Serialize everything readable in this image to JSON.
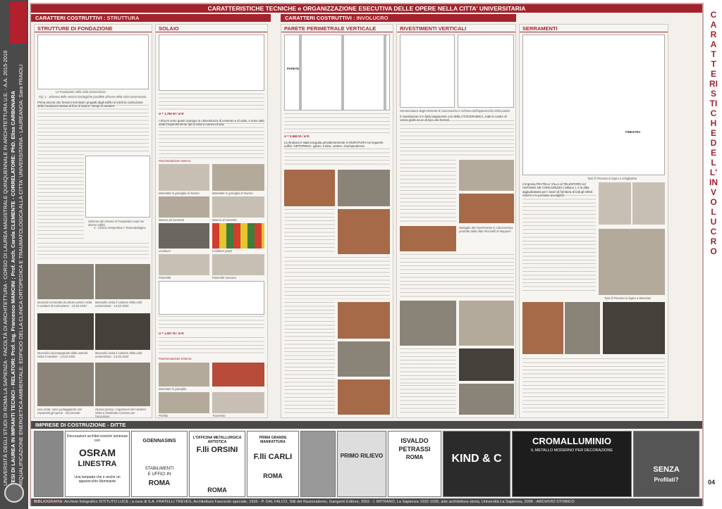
{
  "left_band": {
    "line1": "UNIVERSITÀ DEGLI STUDI DI ROMA  LA SAPIENZA  - FACOLTÀ DI ARCHITETTURA - CORSO DI LAUREA MAGISTRALE QUINQUENNALE IN ARCHITETTURA U.E. - A.A. 2015-2016",
    "line2": "TESI DI LAUREA IN IMPIANTI TECNICI - RELATORI: Prof. Ing. Francesco MANCINI ; Prof. Arch. Carola CLEMENTE - CORRELATORE: PhD. Elisa CARBONARA",
    "line3": "RIQUALIFICAZIONE ENERGETICA AMBIENTALE: EDIFICIO DELLA CLINICA ORTOPEDICA E TRAUMATOLOGICA ALLA CITTA' UNIVERSITARIA  - LAUREANDA: Sara FRAIOLI"
  },
  "banner": "CARATTERISTICHE TECNICHE e ORGANIZZAZIONE ESECUTIVA DELLE OPERE NELLA CITTA' UNIVERSITARIA",
  "sections": {
    "strutt_prefix": "CARATTERI COSTRUTTIVI : ",
    "strutt": "STRUTTURA",
    "invol_prefix": "CARATTERI COSTRUTTIVI : ",
    "invol": "INVOLUCRO"
  },
  "columns": {
    "c1": "STRUTTURE DI FONDAZIONE",
    "c2": "SOLAIO",
    "c3": "PARETE PERIMETRALE VERTICALE",
    "c4": "RIVESTIMENTI VERTICALI",
    "c5": "SERRAMENTI"
  },
  "captions": {
    "fond": "Le Fondazioni nella Città Universitaria",
    "fig1": "Fig. 1 - Schema delle sezioni Geologiche parallele all'asse della Città Universitaria",
    "schema_fond": "Schema dei sistemi di Fondazioni usati nei diversi edifici",
    "fig4": "4 - Clinica Ortopedica e Traumatologica",
    "marmo_grig": "Marmette in graniglia di marmo",
    "marmo_grig2": "Marmette in graniglia di marmo",
    "marmo_cemento": "Marmo ad cemento",
    "marmo_cerata": "Marmo al cemento",
    "linoleum": "Linoleum",
    "linoleum_jaspè": "Linoleum jaspè",
    "pavimenti_interni": "Pavimentazione Interna",
    "pavimenti_esterni": "Pavimentazione Esterna",
    "piastrelle": "Piastrelle",
    "piastrelle_mosaico": "Piastrelle mosaico",
    "marmette_gr": "Marmette in graniglia",
    "porfido": "Porfido",
    "travertino": "Travertino",
    "musiche1": "Musicisti circondati da alcuni uomini visita il cantiere di costruzione - 14.03.1933",
    "musiche2": "Mussolini visita il cantiere della città universitaria - 14.03.1933",
    "muss3": "Mussolini accompagnato dalle autorità visita il cantiere - 14.03.1933",
    "muss4": "Mussolini visita il cantiere della città universitaria - 14.03.1933",
    "visita": "Una visita: sono parlaggiando non rispamiati gli operai - nel periodo",
    "operai": "Operai presso i capannoni del cantiere: Sotto è distribuito il pranzo per l'occasione",
    "nomenclatura": "Nomenclatura degli elementi di Litoceramica e schema dell'apparecchio della partita",
    "dettaglio": "Dettaglio del rivestimento in Litoceramica prodotto dalla ditta Piccinelli di Moppani",
    "finestra1": "Tipo di Finestra in legno e Ghigliottina",
    "finestra2": "Tipo di Finestra in legno a Wasistas"
  },
  "labels": {
    "solaio_u1": "U = 1,760 W / m²K",
    "solaio_u2": "U = 1,007 W / m²K",
    "parete_u": "U = 0,656 W / m²K",
    "solaio_lbl": "Solaio SOLAIO",
    "parete_lbl": "PARETE",
    "finestra_lbl": "FINESTRA"
  },
  "texts": {
    "c1_p1": "Prima ancora che fossero terminati i progetti degli edifici si iniziò la costruzione delle fondazioni stessa al fine di ridurre i tempi di cantiere.",
    "c2_p1": "I SOLAI sono quasi ovunque in calcestruzzo di cemento e di cotto, e sono stati usati frequentemente tipi di solai a camera d'aria.",
    "c3_p1": "La struttura è stata eseguita prevalentemente in MURATURA nei seguenti edifici: ORTOPEDIA, Igiene, Fisica, Lettere, Giurisprudenza.",
    "c4_p1": "Il rivestimento è in fatto largamente con della LITOCERAMICA, tutte le nostre di colore giallo scuro di tipo vari formati.",
    "c5_p1": "L'impresa FRATELLI VILLA di TELESFORO ed ANTONIO DE CONCORIZZO ( Milano ), è la ditta aggiudicataria per i lavori di fornitura di tutti gli infissi esterni e le persiane avvolgibili."
  },
  "imprese_title": "IMPRESE DI COSTRUZIONE - DITTE",
  "ads": {
    "a1_top": "Decorazioni architet-tonichè luminose con",
    "a1_brand1": "OSRAM",
    "a1_brand2": "LINESTRA",
    "a1_bot": "Una lampada che è anche un apparecchio illuminante",
    "a2_brand": "GOENNASINS",
    "a2_line1": "STABILIMENTI",
    "a2_line2": "E UFFICI IN",
    "a2_city": "ROMA",
    "a3_top": "L'OFFICINA METALLURGICA ARTISTICA",
    "a3_brand": "F.lli ORSINI",
    "a3_city": "ROMA",
    "a4_top": "PRIMA GRANDE MANIFATTURA",
    "a4_brand": "F.lli CARLI",
    "a4_city": "ROMA",
    "a5_brand": "PRIMO RILIEVO",
    "a6_brand1": "ISVALDO",
    "a6_brand2": "PETRASSI",
    "a6_city": "ROMA",
    "a7_brand": "KIND & C",
    "a8_brand": "CROMALLUMINIO",
    "a8_sub": "IL METALLO MODERNO PER DECORAZIONE",
    "a9_brand": "SENZA",
    "a9_sub": "Profilati?"
  },
  "bib_label": "BIBLIOGRAFIA",
  "bib": ": Archivio fotografico ISTITUTO LUCE ; a cura di S.A. FRATELLI TREVES, Architettura Fascicolo speciale, 1935 - P. DAL FALCO, Stili del Razionalismo, Gangemi Editore, 2002 - I. MITRANO, La Sapienza 1932-1935, arte architettura storia, Università La Sapienza, 2006 - ARCHIVIO STORICO",
  "right_title": "CARATTERISTICHE DELL' INVOLUCRO",
  "page_no": "04"
}
